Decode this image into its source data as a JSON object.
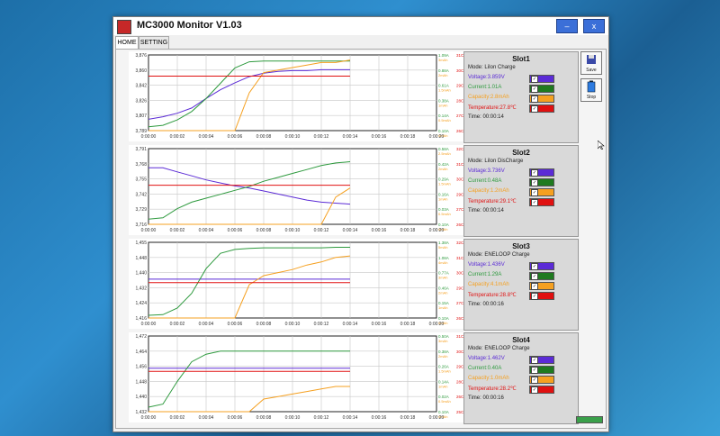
{
  "window": {
    "title": "MC3000 Monitor V1.03"
  },
  "tabs": [
    {
      "label": "HOME"
    },
    {
      "label": "SETTING"
    }
  ],
  "buttons": {
    "save": "Save",
    "stop": "Stop"
  },
  "colors": {
    "voltage": "#5b2bd6",
    "current": "#2e9a3e",
    "capacity": "#f5a020",
    "temperature": "#e01010"
  },
  "x_ticks": [
    "0:00:00",
    "0:00:02",
    "0:00:04",
    "0:00:06",
    "0:00:08",
    "0:00:10",
    "0:00:12",
    "0:00:14",
    "0:00:16",
    "0:00:18",
    "0:00:20"
  ],
  "slots": [
    {
      "title": "Slot1",
      "mode": "Mode: LiIon Charge",
      "voltage": "Voltage:3.859V",
      "current": "Current:1.01A",
      "capacity": "Capacity:2.8mAh",
      "temperature": "Temperature:27.8℃",
      "time": "Time: 00:00:14"
    },
    {
      "title": "Slot2",
      "mode": "Mode: LiIon DisCharge",
      "voltage": "Voltage:3.736V",
      "current": "Current:0.48A",
      "capacity": "Capacity:1.2mAh",
      "temperature": "Temperature:29.1℃",
      "time": "Time: 00:00:14"
    },
    {
      "title": "Slot3",
      "mode": "Mode: ENELOOP Charge",
      "voltage": "Voltage:1.436V",
      "current": "Current:1.29A",
      "capacity": "Capacity:4.1mAh",
      "temperature": "Temperature:28.8℃",
      "time": "Time: 00:00:16"
    },
    {
      "title": "Slot4",
      "mode": "Mode: ENELOOP Charge",
      "voltage": "Voltage:1.462V",
      "current": "Current:0.40A",
      "capacity": "Capacity:1.0mAh",
      "temperature": "Temperature:28.2℃",
      "time": "Time: 00:00:16"
    }
  ],
  "chart_data": [
    {
      "type": "line",
      "x": [
        0,
        1,
        2,
        3,
        4,
        5,
        6,
        7,
        8,
        9,
        10,
        11,
        12,
        13,
        14
      ],
      "left_ticks": [
        "3,876",
        "3,860",
        "3,842",
        "3,826",
        "3,807",
        "3,789"
      ],
      "right_current_ticks": [
        "1.09A",
        "0.88A",
        "0.61A",
        "0.38A",
        "0.14A",
        "0.10A"
      ],
      "right_capacity_ticks": [
        "3mAh",
        "2mAh",
        "1.5mAh",
        "1mAh",
        "0.5mAh",
        "0mAh"
      ],
      "right_temp_ticks": [
        "31C",
        "30C",
        "29C",
        "28C",
        "27C",
        "26C"
      ],
      "ylim_voltage": [
        3.789,
        3.876
      ],
      "ylim_current": [
        0.1,
        1.09
      ],
      "ylim_capacity": [
        0,
        3
      ],
      "ylim_temp": [
        26,
        31
      ],
      "series": [
        {
          "values": [
            3.802,
            3.805,
            3.809,
            3.815,
            3.826,
            3.836,
            3.844,
            3.851,
            3.855,
            3.857,
            3.858,
            3.858,
            3.859,
            3.859,
            3.859
          ]
        },
        {
          "values": [
            0.15,
            0.17,
            0.24,
            0.35,
            0.52,
            0.72,
            0.92,
            1.0,
            1.01,
            1.01,
            1.01,
            1.01,
            1.01,
            1.01,
            1.01
          ]
        },
        {
          "values": [
            0.0,
            0.0,
            0.0,
            0.0,
            0.0,
            0.0,
            0.0,
            1.5,
            2.3,
            2.4,
            2.5,
            2.6,
            2.7,
            2.7,
            2.8
          ]
        },
        {
          "values": [
            29.6,
            29.6,
            29.6,
            29.6,
            29.6,
            29.6,
            29.6,
            29.6,
            29.6,
            29.6,
            29.6,
            29.6,
            29.6,
            29.6,
            29.6
          ]
        }
      ]
    },
    {
      "type": "line",
      "x": [
        0,
        1,
        2,
        3,
        4,
        5,
        6,
        7,
        8,
        9,
        10,
        11,
        12,
        13,
        14
      ],
      "left_ticks": [
        "3,791",
        "3,768",
        "3,755",
        "3,742",
        "3,729",
        "3,716"
      ],
      "right_current_ticks": [
        "0.58A",
        "0.42A",
        "0.29A",
        "0.16A",
        "0.03A",
        "0.10A"
      ],
      "right_capacity_ticks": [
        "2.5mAh",
        "2mAh",
        "1.5mAh",
        "1mAh",
        "0.5mAh",
        "0mAh"
      ],
      "right_temp_ticks": [
        "32C",
        "31C",
        "30C",
        "29C",
        "27C",
        "26C"
      ],
      "ylim_voltage": [
        3.716,
        3.791
      ],
      "ylim_current": [
        0.0,
        0.58
      ],
      "ylim_capacity": [
        0,
        2.5
      ],
      "ylim_temp": [
        26,
        32
      ],
      "series": [
        {
          "values": [
            3.772,
            3.772,
            3.768,
            3.764,
            3.76,
            3.757,
            3.754,
            3.752,
            3.749,
            3.746,
            3.743,
            3.74,
            3.738,
            3.737,
            3.736
          ]
        },
        {
          "values": [
            0.04,
            0.05,
            0.12,
            0.17,
            0.2,
            0.23,
            0.26,
            0.29,
            0.33,
            0.36,
            0.39,
            0.42,
            0.45,
            0.47,
            0.48
          ]
        },
        {
          "values": [
            0.0,
            0.0,
            0.0,
            0.0,
            0.0,
            0.0,
            0.0,
            0.0,
            0.0,
            0.0,
            0.0,
            0.0,
            0.0,
            0.9,
            1.2
          ]
        },
        {
          "values": [
            29.1,
            29.1,
            29.1,
            29.1,
            29.1,
            29.1,
            29.1,
            29.1,
            29.1,
            29.1,
            29.1,
            29.1,
            29.1,
            29.1,
            29.1
          ]
        }
      ]
    },
    {
      "type": "line",
      "x": [
        0,
        1,
        2,
        3,
        4,
        5,
        6,
        7,
        8,
        9,
        10,
        11,
        12,
        13,
        14
      ],
      "left_ticks": [
        "1,455",
        "1,448",
        "1,440",
        "1,432",
        "1,424",
        "1,416"
      ],
      "right_current_ticks": [
        "1.38A",
        "1.08A",
        "0.77A",
        "0.46A",
        "0.15A",
        "0.10A"
      ],
      "right_capacity_ticks": [
        "5mAh",
        "4mAh",
        "3mAh",
        "2mAh",
        "1mAh",
        "0mAh"
      ],
      "right_temp_ticks": [
        "32C",
        "31C",
        "30C",
        "29C",
        "27C",
        "26C"
      ],
      "ylim_voltage": [
        1.416,
        1.455
      ],
      "ylim_current": [
        0.0,
        1.38
      ],
      "ylim_capacity": [
        0,
        5
      ],
      "ylim_temp": [
        26,
        32
      ],
      "series": [
        {
          "values": [
            1.436,
            1.436,
            1.436,
            1.436,
            1.436,
            1.436,
            1.436,
            1.436,
            1.436,
            1.436,
            1.436,
            1.436,
            1.436,
            1.436,
            1.436
          ]
        },
        {
          "values": [
            0.05,
            0.06,
            0.18,
            0.45,
            0.9,
            1.18,
            1.25,
            1.27,
            1.28,
            1.28,
            1.28,
            1.28,
            1.28,
            1.29,
            1.29
          ]
        },
        {
          "values": [
            0.0,
            0.0,
            0.0,
            0.0,
            0.0,
            0.0,
            0.0,
            2.2,
            2.8,
            3.0,
            3.2,
            3.5,
            3.7,
            4.0,
            4.1
          ]
        },
        {
          "values": [
            28.8,
            28.8,
            28.8,
            28.8,
            28.8,
            28.8,
            28.8,
            28.8,
            28.8,
            28.8,
            28.8,
            28.8,
            28.8,
            28.8,
            28.8
          ]
        }
      ]
    },
    {
      "type": "line",
      "x": [
        0,
        1,
        2,
        3,
        4,
        5,
        6,
        7,
        8,
        9,
        10,
        11,
        12,
        13,
        14
      ],
      "left_ticks": [
        "1,472",
        "1,464",
        "1,456",
        "1,448",
        "1,440",
        "1,432"
      ],
      "right_current_ticks": [
        "0.50A",
        "0.38A",
        "0.26A",
        "0.14A",
        "0.02A",
        "0.10A"
      ],
      "right_capacity_ticks": [
        "3mAh",
        "2mAh",
        "1.5mAh",
        "1mAh",
        "0.5mAh",
        "0mAh"
      ],
      "right_temp_ticks": [
        "31C",
        "30C",
        "29C",
        "28C",
        "26C",
        "25C"
      ],
      "ylim_voltage": [
        1.432,
        1.472
      ],
      "ylim_current": [
        0.0,
        0.5
      ],
      "ylim_capacity": [
        0,
        3
      ],
      "ylim_temp": [
        25,
        31
      ],
      "series": [
        {
          "values": [
            1.455,
            1.455,
            1.455,
            1.455,
            1.455,
            1.455,
            1.455,
            1.455,
            1.455,
            1.455,
            1.455,
            1.455,
            1.455,
            1.455,
            1.455
          ]
        },
        {
          "values": [
            0.03,
            0.05,
            0.2,
            0.33,
            0.38,
            0.4,
            0.4,
            0.4,
            0.4,
            0.4,
            0.4,
            0.4,
            0.4,
            0.4,
            0.4
          ]
        },
        {
          "values": [
            0.0,
            0.0,
            0.0,
            0.0,
            0.0,
            0.0,
            0.0,
            0.0,
            0.5,
            0.6,
            0.7,
            0.8,
            0.9,
            1.0,
            1.0
          ]
        },
        {
          "values": [
            28.2,
            28.2,
            28.2,
            28.2,
            28.2,
            28.2,
            28.2,
            28.2,
            28.2,
            28.2,
            28.2,
            28.2,
            28.2,
            28.2,
            28.2
          ]
        }
      ]
    }
  ]
}
